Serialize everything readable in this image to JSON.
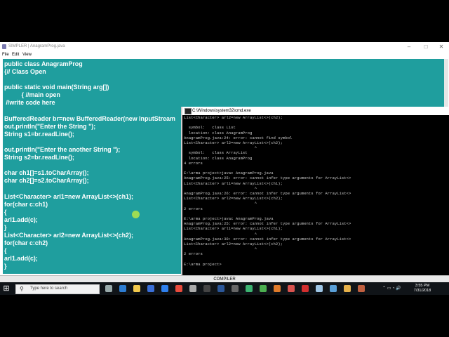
{
  "editor": {
    "window_title": "SIMPLER | AnagramProg.java",
    "menu": [
      "File",
      "Edit",
      "View"
    ],
    "code_lines": [
      "public class AnagramProg",
      "{// Class Open",
      "",
      "public static void main(String arg[])",
      "          { //main open",
      " //write code here",
      "",
      "BufferedReader br=new BufferedReader(new InputStream",
      "out.println(\"Enter the String \");",
      "String s1=br.readLine();",
      "",
      "out.println(\"Enter the another String \");",
      "String s2=br.readLine();",
      "",
      "char ch1[]=s1.toCharArray();",
      "char ch2[]=s2.toCharArray();",
      "",
      "List<Character> arl1=new ArrayList<>(ch1);",
      "for(char c:ch1)",
      "{",
      "arl1.add(c);",
      "}",
      "List<Character> arl2=new ArrayList<>(ch2);",
      "for(char c:ch2)",
      "{",
      "arl1.add(c);",
      "}"
    ]
  },
  "cmd": {
    "window_title": "C:\\Windows\\system32\\cmd.exe",
    "lines": [
      "List<Character> arl2=new ArrayList<>(ch2);",
      "",
      "  symbol:   class List",
      "  location: class AnagramProg",
      "AnagramProg.java:24: error: cannot find symbol",
      "List<Character> arl2=new ArrayList<>(ch2);",
      "                              ^",
      "  symbol:   class ArrayList",
      "  location: class AnagramProg",
      "4 errors",
      "",
      "E:\\arma project>javac AnagramProg.java",
      "AnagramProg.java:25: error: cannot infer type arguments for ArrayList<>",
      "List<Character> arl1=new ArrayList<>(ch1);",
      "                              ^",
      "AnagramProg.java:26: error: cannot infer type arguments for ArrayList<>",
      "List<Character> arl2=new ArrayList<>(ch2);",
      "                              ^",
      "2 errors",
      "",
      "E:\\arma project>javac AnagramProg.java",
      "AnagramProg.java:25: error: cannot infer type arguments for ArrayList<>",
      "List<Character> arl1=new ArrayList<>(ch1);",
      "                              ^",
      "AnagramProg.java:30: error: cannot infer type arguments for ArrayList<>",
      "List<Character> arl2=new ArrayList<>(ch2);",
      "                              ^",
      "2 errors",
      "",
      "E:\\arma project>"
    ]
  },
  "compiler_bar": {
    "label": "COMPILER"
  },
  "taskbar": {
    "search_placeholder": "Type here to search",
    "time": "3:55 PM",
    "date": "7/31/2018",
    "icons": [
      {
        "name": "task-view-icon",
        "color": "#9aa"
      },
      {
        "name": "edge-icon",
        "color": "#2d7dd2"
      },
      {
        "name": "file-explorer-icon",
        "color": "#f2c94c"
      },
      {
        "name": "store-icon",
        "color": "#3a6fd8"
      },
      {
        "name": "mail-icon",
        "color": "#2f80ed"
      },
      {
        "name": "chrome-icon",
        "color": "#e94b3c"
      },
      {
        "name": "settings-icon",
        "color": "#aaa"
      },
      {
        "name": "cmd-icon",
        "color": "#444"
      },
      {
        "name": "word-icon",
        "color": "#2b579a"
      },
      {
        "name": "calculator-icon",
        "color": "#666"
      },
      {
        "name": "green-app-icon",
        "color": "#3cb371"
      },
      {
        "name": "camtasia-icon",
        "color": "#4caf50"
      },
      {
        "name": "java-icon",
        "color": "#e07b2a"
      },
      {
        "name": "media-icon",
        "color": "#d9534f"
      },
      {
        "name": "acrobat-icon",
        "color": "#d32f2f"
      },
      {
        "name": "notepad-icon",
        "color": "#9ec6e6"
      },
      {
        "name": "photos-icon",
        "color": "#5aa0d8"
      },
      {
        "name": "folder-icon",
        "color": "#e6b14a"
      },
      {
        "name": "recorder-icon",
        "color": "#c06040"
      }
    ]
  }
}
